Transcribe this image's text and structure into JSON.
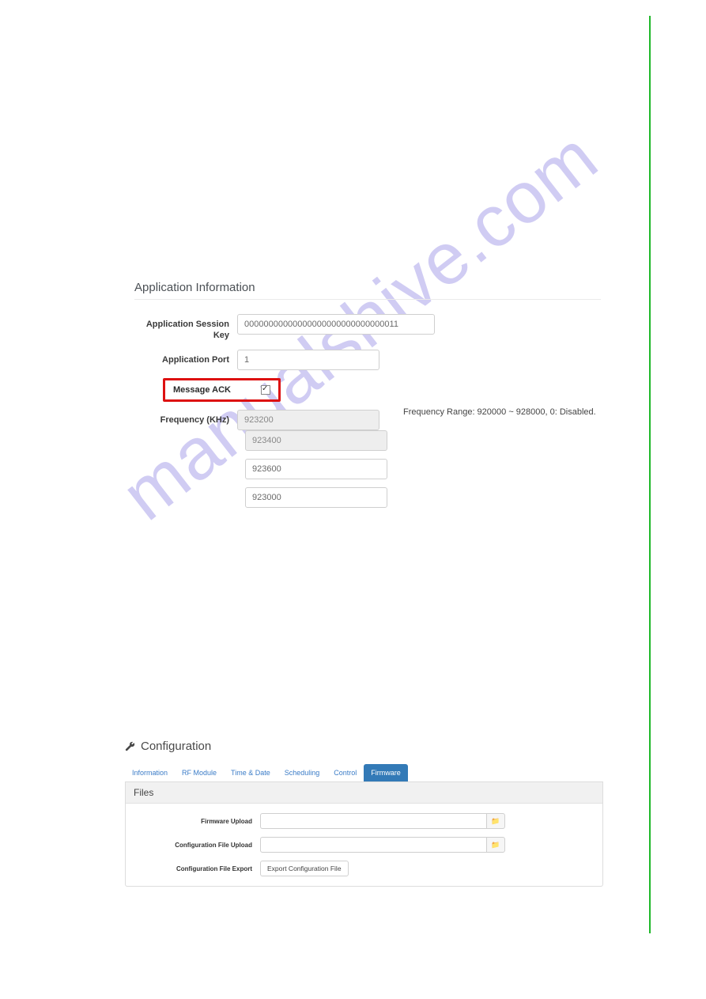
{
  "watermark": "manualshive.com",
  "appInfo": {
    "title": "Application Information",
    "sessionKeyLabel": "Application Session Key",
    "sessionKeyValue": "00000000000000000000000000000011",
    "portLabel": "Application Port",
    "portValue": "1",
    "msgAckLabel": "Message ACK",
    "msgAckChecked": true,
    "freqLabel": "Frequency (KHz)",
    "freqValues": [
      "923200",
      "923400",
      "923600",
      "923000"
    ],
    "freqNote": "Frequency Range: 920000 ~ 928000, 0: Disabled."
  },
  "config": {
    "title": "Configuration",
    "tabs": [
      "Information",
      "RF Module",
      "Time & Date",
      "Scheduling",
      "Control",
      "Firmware"
    ],
    "activeTab": 5,
    "panelTitle": "Files",
    "rows": {
      "firmwareUploadLabel": "Firmware Upload",
      "configUploadLabel": "Configuration File Upload",
      "configExportLabel": "Configuration File Export",
      "exportButton": "Export Configuration File"
    }
  }
}
